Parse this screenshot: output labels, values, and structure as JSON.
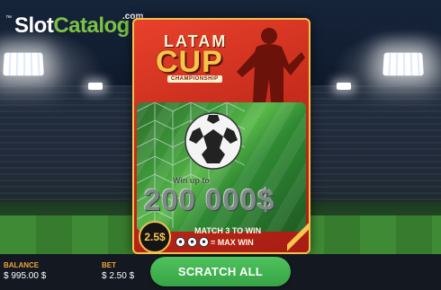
{
  "logo": {
    "slot": "Slot",
    "catalog": "Catalog",
    "com": ".com",
    "mark": "™"
  },
  "ticket": {
    "title_line1": "LATAM",
    "title_line2": "CUP",
    "subtitle": "CHAMPIONSHIP",
    "prize_subtext": "Win up to",
    "prize_amount": "200 000$",
    "bet_badge": "2.5$",
    "rule_line1": "MATCH 3 TO WIN",
    "rule_line2": "= MAX WIN"
  },
  "footer": {
    "balance_label": "BALANCE",
    "balance_value": "$ 995.00 $",
    "bet_label": "BET",
    "bet_value": "$ 2.50 $",
    "scratch_all_label": "SCRATCH ALL"
  },
  "colors": {
    "accent_green": "#35a446",
    "ticket_red": "#c62c1c",
    "gold": "#f6c54b",
    "label_orange": "#f0a43a"
  }
}
